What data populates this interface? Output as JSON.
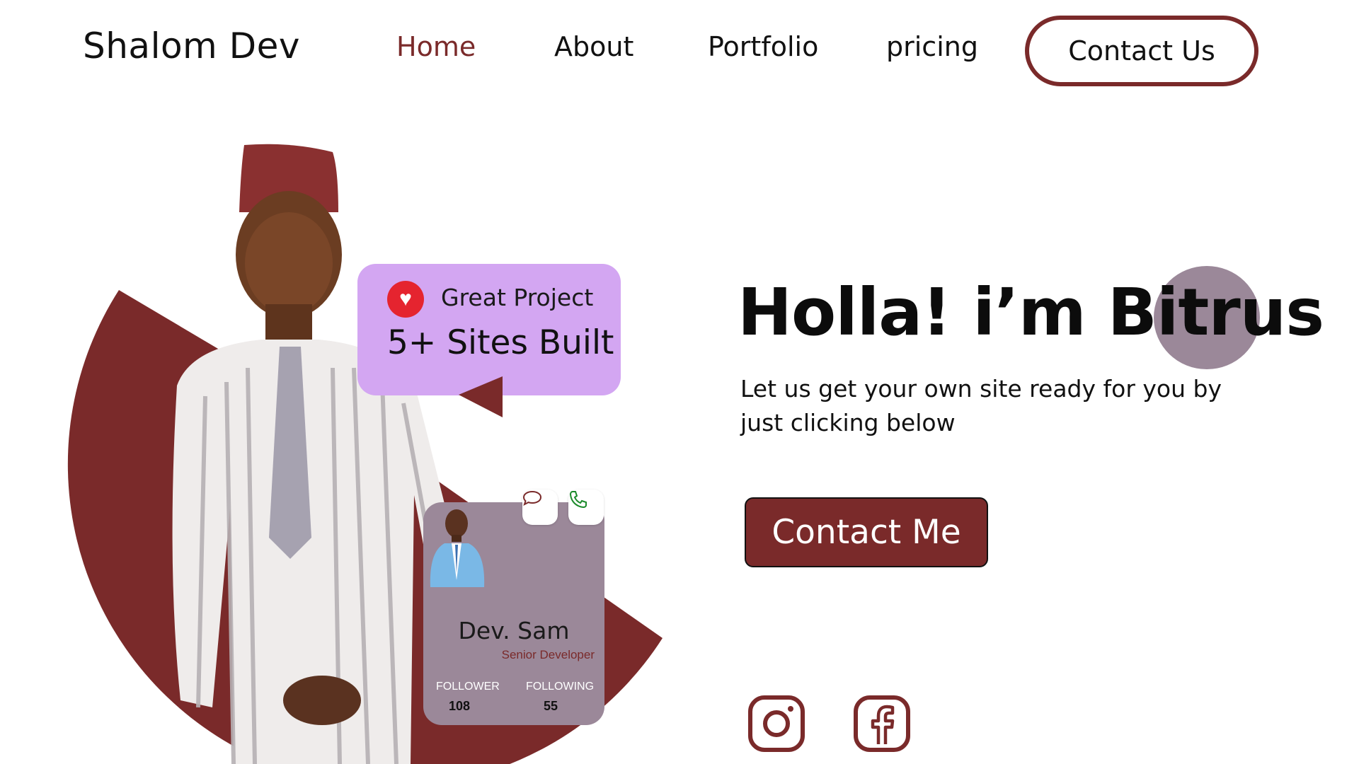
{
  "nav": {
    "brand": "Shalom Dev",
    "links": [
      "Home",
      "About",
      "Portfolio",
      "pricing"
    ],
    "active": "Home",
    "cta": "Contact  Us"
  },
  "badge": {
    "icon": "heart-icon",
    "label": "Great Project",
    "value": "5+ Sites Built"
  },
  "profile_card": {
    "name": "Dev. Sam",
    "role": "Senior Developer",
    "follower_label": "FOLLOWER",
    "follower_count": "108",
    "following_label": "FOLLOWING",
    "following_count": "55",
    "icons": [
      "chat-bubble-icon",
      "phone-icon"
    ]
  },
  "hero": {
    "title": "Holla! i’m Bitrus",
    "subtitle": "Let us get your own site ready for you by just clicking below",
    "cta": "Contact Me"
  },
  "social": {
    "icons": [
      "instagram-icon",
      "facebook-icon"
    ]
  },
  "colors": {
    "accent": "#7a2a2a",
    "badge_bg": "#d3a6f2",
    "card_bg": "#9b8899",
    "heart": "#e5242f"
  }
}
